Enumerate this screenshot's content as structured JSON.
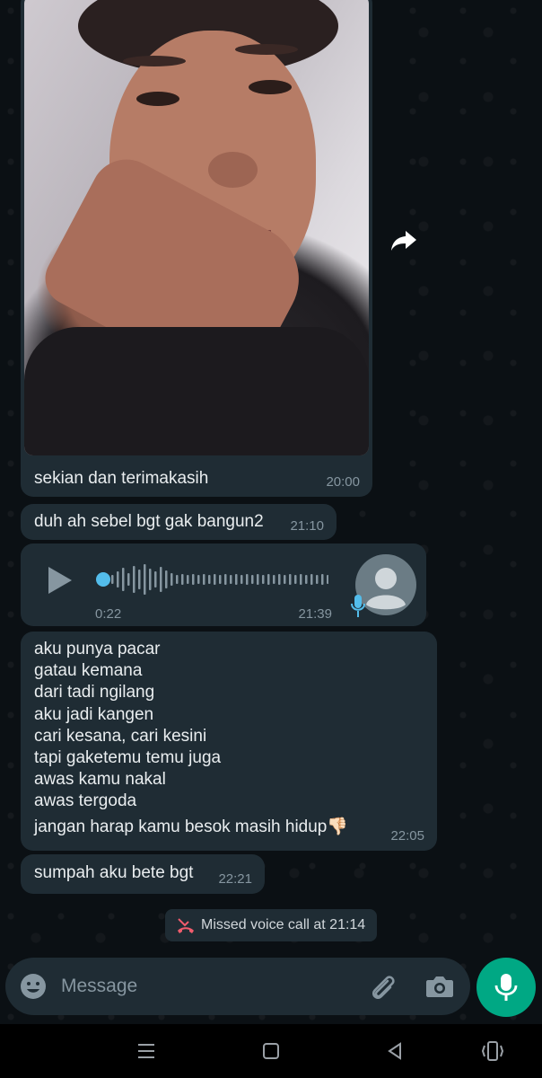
{
  "messages": {
    "image_caption": {
      "text": "sekian dan terimakasih",
      "time": "20:00"
    },
    "msg2": {
      "text": "duh ah sebel bgt gak bangun2",
      "time": "21:10"
    },
    "voice": {
      "duration": "0:22",
      "time": "21:39",
      "progress": 0
    },
    "poem": {
      "lines": [
        "aku punya pacar",
        "gatau kemana",
        "dari tadi ngilang",
        "aku jadi kangen",
        "cari kesana, cari kesini",
        "tapi gaketemu temu juga",
        "awas kamu nakal",
        "awas tergoda",
        "jangan harap kamu besok masih hidup👎🏻"
      ],
      "time": "22:05"
    },
    "msg5": {
      "text": "sumpah aku bete bgt",
      "time": "22:21"
    }
  },
  "system": {
    "missed_call": "Missed voice call at 21:14"
  },
  "composer": {
    "placeholder": "Message"
  },
  "colors": {
    "bubble": "#1f2c34",
    "background": "#0b1014",
    "accent": "#00a884",
    "voice_dot": "#53bdeb",
    "missed_icon": "#f15c6d"
  },
  "icons": {
    "forward": "forward-icon",
    "play": "play-icon",
    "mic_badge": "mic-icon",
    "avatar": "avatar-icon",
    "missed_call": "missed-call-icon",
    "emoji": "emoji-icon",
    "attach": "paperclip-icon",
    "camera": "camera-icon",
    "mic_button": "mic-icon",
    "nav": [
      "recents-icon",
      "home-icon",
      "back-icon",
      "rotate-icon"
    ]
  }
}
